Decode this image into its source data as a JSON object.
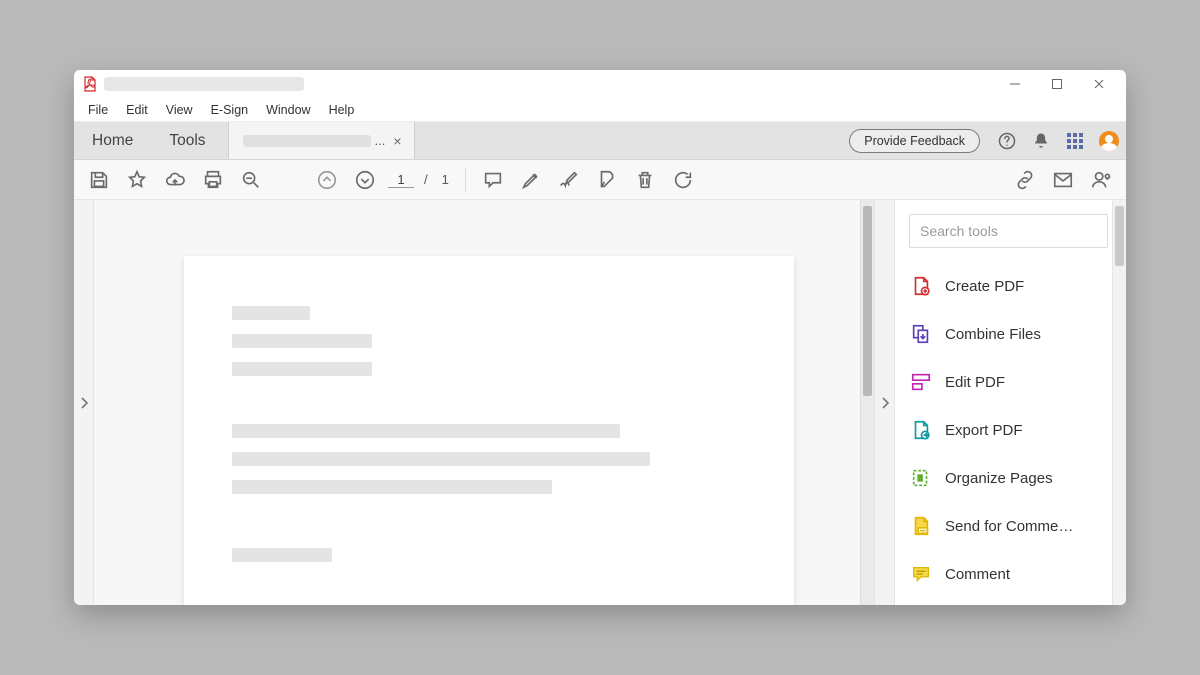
{
  "menubar": [
    "File",
    "Edit",
    "View",
    "E-Sign",
    "Window",
    "Help"
  ],
  "nav": {
    "home": "Home",
    "tools": "Tools",
    "doc_ellipsis": "...",
    "feedback": "Provide Feedback"
  },
  "paging": {
    "current": "1",
    "sep": "/",
    "total": "1"
  },
  "tools": {
    "search_placeholder": "Search tools",
    "items": [
      "Create PDF",
      "Combine Files",
      "Edit PDF",
      "Export PDF",
      "Organize Pages",
      "Send for Comme…",
      "Comment"
    ]
  }
}
